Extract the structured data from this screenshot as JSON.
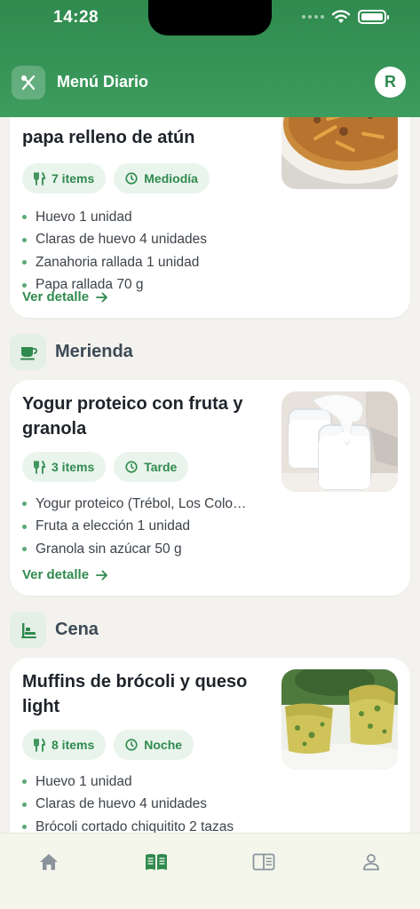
{
  "status": {
    "time": "14:28"
  },
  "header": {
    "title": "Menú Diario",
    "avatar_initial": "R"
  },
  "meals": [
    {
      "title": "papa relleno de atún",
      "items": "7 items",
      "time": "Mediodía",
      "ingredients": [
        "Huevo 1 unidad",
        "Claras de huevo 4 unidades",
        "Zanahoria rallada 1 unidad",
        "Papa rallada 70 g"
      ],
      "detail_label": "Ver detalle"
    },
    {
      "section": "Merienda",
      "title": "Yogur proteico con fruta y granola",
      "items": "3 items",
      "time": "Tarde",
      "ingredients": [
        "Yogur proteico (Trébol, Los Colo…",
        "Fruta a elección 1 unidad",
        "Granola sin azúcar 50 g"
      ],
      "detail_label": "Ver detalle"
    },
    {
      "section": "Cena",
      "title": "Muffins de brócoli y queso light",
      "items": "8 items",
      "time": "Noche",
      "ingredients": [
        "Huevo 1 unidad",
        "Claras de huevo 4 unidades",
        "Brócoli cortado chiquitito 2 tazas"
      ]
    }
  ],
  "nav": {
    "items": [
      "home-icon",
      "book-open-icon",
      "reader-icon",
      "profile-icon"
    ],
    "active_index": 1
  },
  "colors": {
    "brand": "#2f8a4e",
    "chip_bg": "#e9f4ec",
    "page_bg": "#f3f2ee"
  }
}
